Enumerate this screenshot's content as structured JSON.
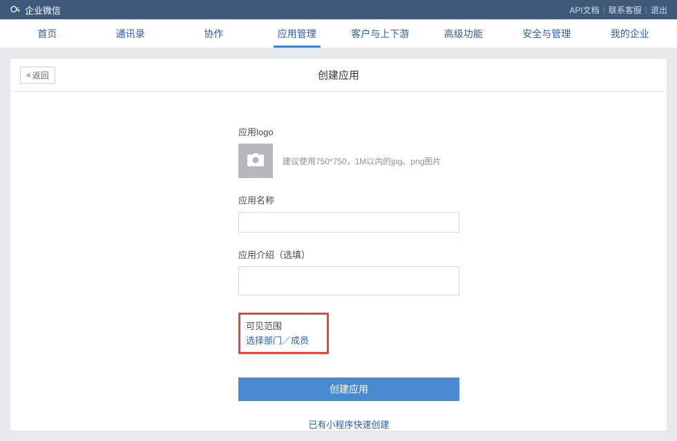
{
  "topbar": {
    "brand": "企业微信",
    "api_docs": "API文档",
    "contact": "联系客服",
    "logout": "退出"
  },
  "nav": {
    "items": [
      {
        "label": "首页"
      },
      {
        "label": "通讯录"
      },
      {
        "label": "协作"
      },
      {
        "label": "应用管理"
      },
      {
        "label": "客户与上下游"
      },
      {
        "label": "高级功能"
      },
      {
        "label": "安全与管理"
      },
      {
        "label": "我的企业"
      }
    ],
    "active_index": 3
  },
  "card": {
    "back": "返回",
    "title": "创建应用"
  },
  "form": {
    "logo_label": "应用logo",
    "logo_hint": "建议使用750*750，1M以内的jpg、png图片",
    "name_label": "应用名称",
    "name_value": "",
    "desc_label": "应用介绍（选填）",
    "desc_value": "",
    "scope_label": "可见范围",
    "scope_link": "选择部门／成员",
    "submit": "创建应用",
    "quick_link": "已有小程序快速创建"
  }
}
